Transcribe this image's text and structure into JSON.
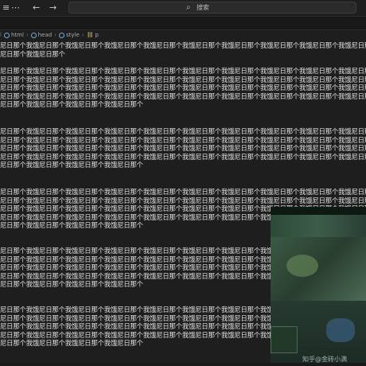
{
  "titlebar": {
    "icons": [
      "menu-icon",
      "more-icon",
      "back-icon",
      "forward-icon"
    ],
    "glyphs": [
      "≡",
      "⋯",
      "←",
      "→"
    ],
    "search_icon_glyph": "⌕",
    "search_text": "搜索"
  },
  "breadcrumbs": {
    "items": [
      "html",
      "head",
      "style",
      "p"
    ]
  },
  "editor": {
    "paragraphs": [
      {
        "lines": [
          "尼日那个我饿尼日那个我饿尼日那个我饿尼日那个我饿尼日那个我饿尼日那个我饿尼日那个我饿尼日那个我饿尼日那个我饿尼日那个我饿尼日那个",
          "尼日那个我饿尼日那个"
        ]
      },
      {
        "lines": [
          "尼日那个我饿尼日那个我饿尼日那个我饿尼日那个我饿尼日那个我饿尼日那个我饿尼日那个我饿尼日那个我饿尼日那个我饿尼日那个我饿尼日那个",
          "尼日那个我饿尼日那个我饿尼日那个我饿尼日那个我饿尼日那个我饿尼日那个我饿尼日那个我饿尼日那个我饿尼日那个我饿尼日那个我饿尼日那个",
          "尼日那个我饿尼日那个我饿尼日那个我饿尼日那个我饿尼日那个我饿尼日那个我饿尼日那个我饿尼日那个我饿尼日那个我饿尼日那个我饿尼日那个",
          "尼日那个我饿尼日那个我饿尼日那个我饿尼日那个我饿尼日那个我饿尼日那个我饿尼日那个我饿尼日那个我饿尼日那个我饿尼日那个我饿尼日那个",
          "尼日那个我饿尼日那个我饿尼日那个我饿尼日那个"
        ]
      },
      {
        "lines": [
          "尼日那个我饿尼日那个我饿尼日那个我饿尼日那个我饿尼日那个我饿尼日那个我饿尼日那个我饿尼日那个我饿尼日那个我饿尼日那个我饿尼日那个",
          "尼日那个我饿尼日那个我饿尼日那个我饿尼日那个我饿尼日那个我饿尼日那个我饿尼日那个我饿尼日那个我饿尼日那个我饿尼日那个我饿尼日那个",
          "尼日那个我饿尼日那个我饿尼日那个我饿尼日那个我饿尼日那个我饿尼日那个我饿尼日那个我饿尼日那个我饿尼日那个我饿尼日那个我饿尼日那个",
          "尼日那个我饿尼日那个我饿尼日那个我饿尼日那个我饿尼日那个我饿尼日那个我饿尼日那个我饿尼日那个我饿尼日那个我饿尼日那个我饿尼日那个",
          "尼日那个我饿尼日那个我饿尼日那个我饿尼日那个"
        ]
      },
      {
        "lines": [
          "尼日那个我饿尼日那个我饿尼日那个我饿尼日那个我饿尼日那个我饿尼日那个我饿尼日那个我饿尼日那个我饿尼日那个我饿尼日那个我饿尼日那个",
          "尼日那个我饿尼日那个我饿尼日那个我饿尼日那个我饿尼日那个我饿尼日那个我饿尼日那个我饿尼日那个我饿尼日那个我饿尼日那个我饿尼日那个",
          "尼日那个我饿尼日那个我饿尼日那个我饿尼日那个我饿尼日那个我饿尼日那个我饿尼日那个我饿尼日那个我饿尼日那个我饿尼日那个我饿尼日那个",
          "尼日那个我饿尼日那个我饿尼日那个我饿尼日那个我饿尼日那个我饿尼日那个我饿尼日那个我饿尼日那个我饿尼日那个我饿尼日那个我饿尼日那个",
          "尼日那个我饿尼日那个我饿尼日那个我饿尼日那个"
        ]
      },
      {
        "lines": [
          "尼日那个我饿尼日那个我饿尼日那个我饿尼日那个我饿尼日那个我饿尼日那个我饿尼日那个我饿尼日那个我饿尼日那个我饿尼日那个我饿尼日那个",
          "尼日那个我饿尼日那个我饿尼日那个我饿尼日那个我饿尼日那个我饿尼日那个我饿尼日那个我饿尼日那个我饿尼日那个我饿尼日那个我饿尼日那个",
          "尼日那个我饿尼日那个我饿尼日那个我饿尼日那个我饿尼日那个我饿尼日那个我饿尼日那个我饿尼日那个我饿尼日那个我饿尼日那个我饿尼日那个",
          "尼日那个我饿尼日那个我饿尼日那个我饿尼日那个我饿尼日那个我饿尼日那个我饿尼日那个我饿尼日那个我饿尼日那个我饿尼日那个我饿尼日那个",
          "尼日那个我饿尼日那个我饿尼日那个我饿尼日那个"
        ]
      },
      {
        "lines": [
          "尼日那个我饿尼日那个我饿尼日那个我饿尼日那个我饿尼日那个我饿尼日那个我饿尼日那个我饿尼日那个我饿尼日那个我饿尼日那个我饿尼日那个",
          "尼日那个我饿尼日那个我饿尼日那个我饿尼日那个我饿尼日那个我饿尼日那个我饿尼日那个我饿尼日那个我饿尼日那个我饿尼日那个我饿尼日那个",
          "尼日那个我饿尼日那个我饿尼日那个我饿尼日那个我饿尼日那个我饿尼日那个我饿尼日那个我饿尼日那个我饿尼日那个我饿尼日那个我饿尼日那个",
          "尼日那个我饿尼日那个我饿尼日那个我饿尼日那个我饿尼日那个我饿尼日那个我饿尼日那个我饿尼日那个我饿尼日那个我饿尼日那个我饿尼日那个",
          "尼日那个我饿尼日那个我饿尼日那个我饿尼日那个"
        ]
      }
    ]
  },
  "overlay": {
    "watermark_text": "知乎@金砖小满"
  }
}
